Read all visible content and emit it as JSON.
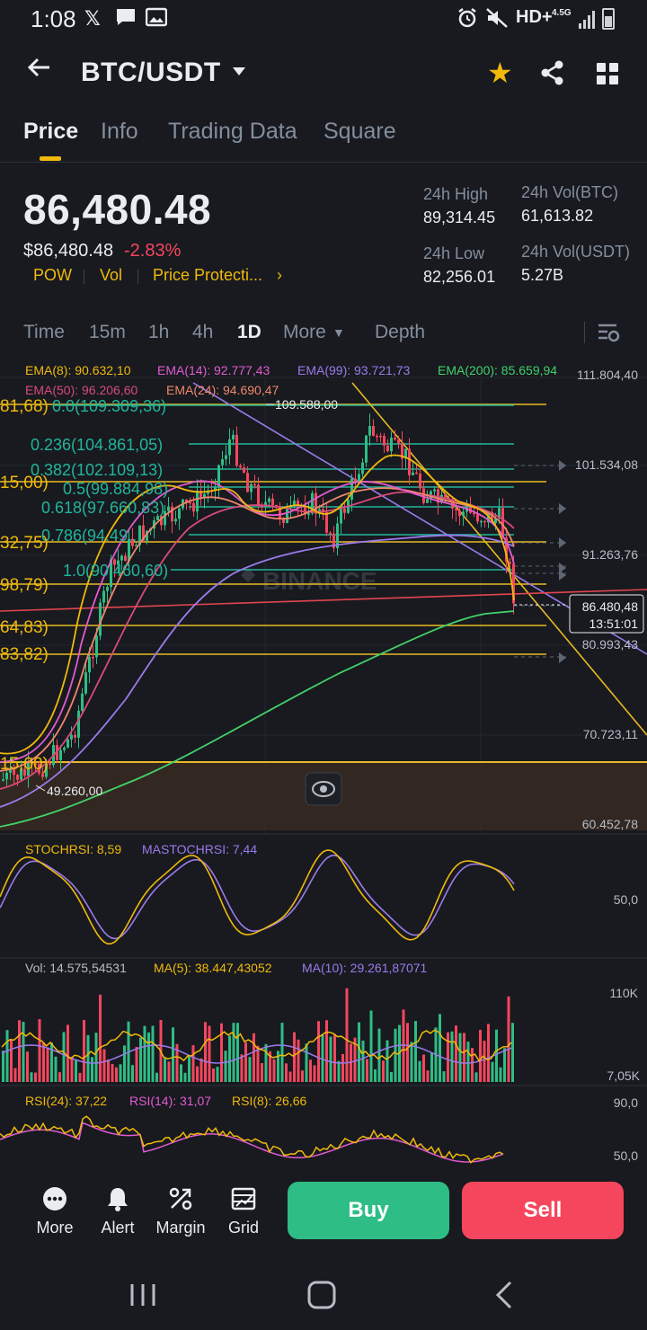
{
  "status_bar": {
    "time": "1:08",
    "network": "HD+",
    "network_sub": "4.5G"
  },
  "header": {
    "pair": "BTC/USDT"
  },
  "tabs": [
    {
      "label": "Price",
      "active": true
    },
    {
      "label": "Info",
      "active": false
    },
    {
      "label": "Trading Data",
      "active": false
    },
    {
      "label": "Square",
      "active": false
    }
  ],
  "ticker": {
    "last_price": "86,480.48",
    "usd_price": "$86,480.48",
    "change": "-2.83%",
    "tags": [
      "POW",
      "Vol",
      "Price Protecti..."
    ],
    "high_label": "24h High",
    "high_value": "89,314.45",
    "low_label": "24h Low",
    "low_value": "82,256.01",
    "vol_btc_label": "24h Vol(BTC)",
    "vol_btc_value": "61,613.82",
    "vol_usdt_label": "24h Vol(USDT)",
    "vol_usdt_value": "5.27B"
  },
  "intervals": [
    {
      "label": "Time",
      "active": false
    },
    {
      "label": "15m",
      "active": false
    },
    {
      "label": "1h",
      "active": false
    },
    {
      "label": "4h",
      "active": false
    },
    {
      "label": "1D",
      "active": true
    },
    {
      "label": "More",
      "active": false
    },
    {
      "label": "Depth",
      "active": false
    }
  ],
  "chart": {
    "ema_row1": [
      {
        "text": "EMA(8): 90.632,10",
        "color": "#f0b90b"
      },
      {
        "text": "EMA(14): 92.777,43",
        "color": "#e25bd0"
      },
      {
        "text": "EMA(99): 93.721,73",
        "color": "#9b7bea"
      },
      {
        "text": "EMA(200): 85.659,94",
        "color": "#43d16a"
      }
    ],
    "ema_row2": [
      {
        "text": "EMA(50): 96.206,60",
        "color": "#d94a7a"
      },
      {
        "text": "EMA(24): 94.690,47",
        "color": "#f0876a"
      }
    ],
    "price_axis": [
      "111.804,40",
      "101.534,08",
      "91.263,76",
      "80.993,43",
      "70.723,11",
      "60.452,78"
    ],
    "current_price_label": "86.480,48",
    "countdown": "13:51:01",
    "high_marker": "109.588,00",
    "low_marker": "49.260,00",
    "fib_levels": [
      "0.0(109.309,36)",
      "0.236(104.861,05)",
      "0.382(102.109,13)",
      "0.5(99.884,98)",
      "0.618(97.660,83)",
      "0.786(94.49...",
      "1.0(90.460,60)"
    ],
    "left_levels": [
      "81,68)",
      "15,00)",
      "32,75)",
      "98,79)",
      "64,83)",
      "83,82)",
      "15,00)"
    ],
    "watermark": "BINANCE",
    "stochrsi": {
      "k": "STOCHRSI: 8,59",
      "d": "MASTOCHRSI: 7,44",
      "axis": "50,0"
    },
    "volume": {
      "vol": "Vol: 14.575,54531",
      "ma5": "MA(5): 38.447,43052",
      "ma10": "MA(10): 29.261,87071",
      "axis_top": "110K",
      "axis_bottom": "7,05K"
    },
    "rsi": {
      "r24": "RSI(24): 37,22",
      "r14": "RSI(14): 31,07",
      "r8": "RSI(8): 26,66",
      "axis_top": "90,0",
      "axis_mid": "50,0"
    }
  },
  "actions": [
    {
      "label": "More",
      "icon": "more-icon"
    },
    {
      "label": "Alert",
      "icon": "bell-icon"
    },
    {
      "label": "Margin",
      "icon": "margin-icon"
    },
    {
      "label": "Grid",
      "icon": "grid-bot-icon"
    }
  ],
  "buy_label": "Buy",
  "sell_label": "Sell",
  "colors": {
    "up": "#2ebd85",
    "down": "#f6465d",
    "accent": "#f0b90b",
    "bg": "#181a20"
  }
}
